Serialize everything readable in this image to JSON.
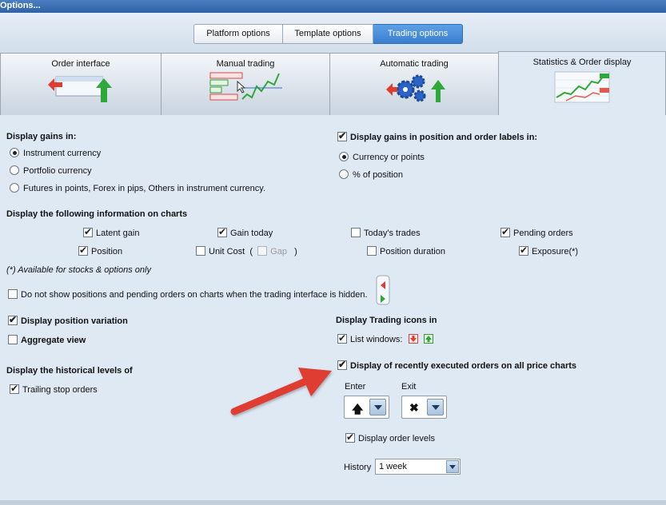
{
  "window": {
    "title": "Options..."
  },
  "top_tabs": [
    "Platform options",
    "Template options",
    "Trading options"
  ],
  "sub_tabs": [
    "Order interface",
    "Manual trading",
    "Automatic trading",
    "Statistics & Order display"
  ],
  "gains": {
    "heading": "Display gains in:",
    "options": [
      "Instrument currency",
      "Portfolio currency",
      "Futures in points, Forex in pips, Others in instrument currency."
    ]
  },
  "labels_gains": {
    "heading": "Display gains in position and order labels in:",
    "options": [
      "Currency or points",
      "% of position"
    ]
  },
  "charts_info": {
    "heading": "Display the following information on charts",
    "latent_gain": "Latent gain",
    "gain_today": "Gain today",
    "todays_trades": "Today's trades",
    "pending_orders": "Pending orders",
    "position": "Position",
    "unit_cost": "Unit Cost",
    "paren_open": "(",
    "gap": "Gap",
    "paren_close": ")",
    "position_duration": "Position duration",
    "exposure": "Exposure(*)",
    "footnote": "(*) Available for stocks & options only"
  },
  "hide_positions": "Do not show positions and pending orders on charts when the trading interface is hidden.",
  "display_position_variation": "Display position variation",
  "aggregate_view": "Aggregate view",
  "historical": {
    "heading": "Display the historical levels of",
    "trailing": "Trailing stop orders"
  },
  "trading_icons": {
    "heading": "Display Trading icons in",
    "list_windows": "List windows:"
  },
  "executed_orders": {
    "heading": "Display of recently executed orders on all price charts",
    "enter_label": "Enter",
    "exit_label": "Exit",
    "enter_icon": "up-arrow-icon",
    "exit_icon": "cross-icon",
    "display_order_levels": "Display order levels",
    "history_label": "History",
    "history_value": "1 week"
  },
  "colors": {
    "accent": "#3a7ed0",
    "arrow": "#e03c31",
    "green": "#2fa83a"
  }
}
